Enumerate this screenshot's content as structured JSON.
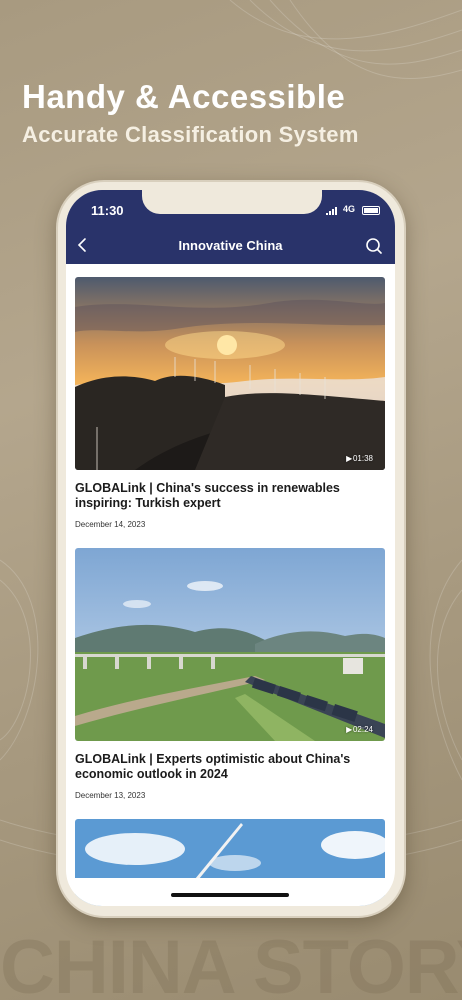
{
  "promo": {
    "headline": "Handy & Accessible",
    "subheadline": "Accurate Classification System",
    "watermark": "CHINA STORY"
  },
  "status_bar": {
    "time": "11:30",
    "network": "4G"
  },
  "nav": {
    "title": "Innovative China",
    "back_icon": "chevron-left-icon",
    "search_icon": "search-icon"
  },
  "articles": [
    {
      "title": "GLOBALink | China's success in renewables inspiring: Turkish expert",
      "date": "December 14, 2023",
      "duration": "01:38"
    },
    {
      "title": "GLOBALink | Experts optimistic about China's economic outlook in 2024",
      "date": "December 13, 2023",
      "duration": "02:24"
    },
    {
      "title": "",
      "date": "",
      "duration": ""
    }
  ],
  "colors": {
    "nav_bar": "#29336a",
    "background": "#a89a80"
  }
}
